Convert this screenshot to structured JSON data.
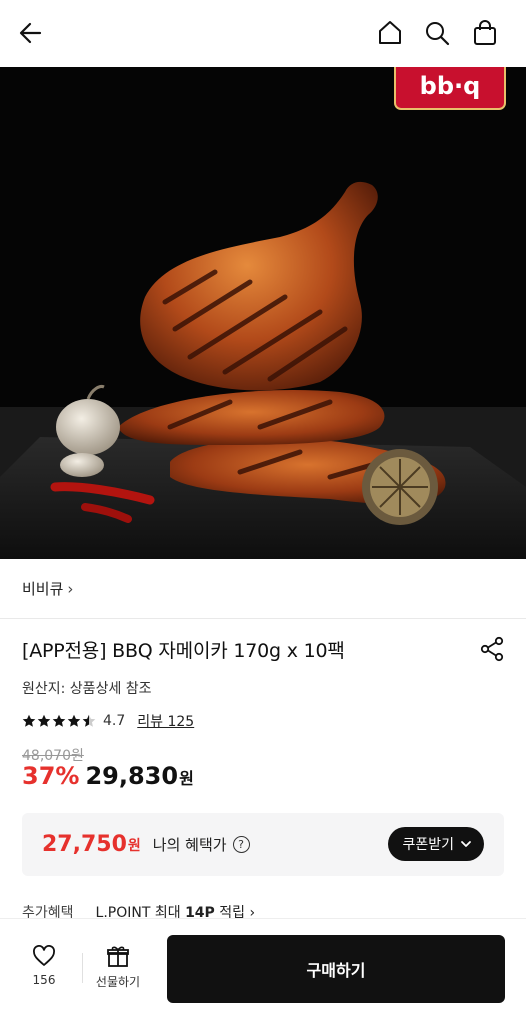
{
  "header": {
    "back_icon": "arrow-left-icon",
    "home_icon": "home-icon",
    "search_icon": "search-icon",
    "cart_icon": "shopping-bag-icon"
  },
  "hero": {
    "logo_text": "bb·q",
    "logo_color": "#c8102e"
  },
  "brand": {
    "name": "비비큐",
    "chevron": "›"
  },
  "product": {
    "title": "[APP전용] BBQ 자메이카 170g x 10팩",
    "origin": "원산지: 상품상세 참조",
    "rating": "4.7",
    "rating_stars": 4.7,
    "review_text": "리뷰 125",
    "original_price": "48,070원",
    "discount": "37%",
    "price": "29,830",
    "price_unit": "원"
  },
  "benefit": {
    "price": "27,750",
    "unit": "원",
    "label": "나의 혜택가",
    "help": "?",
    "coupon_label": "쿠폰받기"
  },
  "extra": {
    "label": "추가혜택",
    "value_prefix": "L.POINT 최대 ",
    "value_bold": "14P",
    "value_suffix": " 적립 ›"
  },
  "bottom": {
    "like_count": "156",
    "gift_label": "선물하기",
    "buy_label": "구매하기"
  },
  "colors": {
    "accent_red": "#e6312d",
    "dark": "#111111"
  }
}
